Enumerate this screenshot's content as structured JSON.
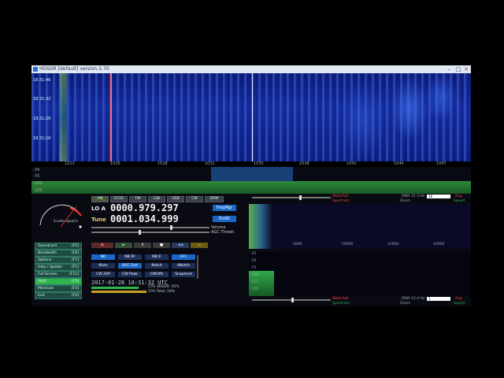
{
  "window": {
    "title": "HDSDR [default] version 2.70"
  },
  "waterfall": {
    "times": [
      "18:31:46",
      "18:31:32",
      "18:31:26",
      "18:31:16"
    ],
    "freq_ticks": [
      "1023",
      "1026",
      "1028",
      "1032",
      "1035",
      "1038",
      "1041",
      "1044",
      "1047"
    ]
  },
  "spectrum": {
    "level_ticks": [
      "-34",
      "-75",
      "-104",
      "-125"
    ]
  },
  "meter": {
    "label": "S-units Squelch"
  },
  "mode_buttons": [
    "AM",
    "ECSS",
    "FM",
    "LSB",
    "USB",
    "CW",
    "DRM"
  ],
  "lo": {
    "label": "LO A",
    "value": "0000.979.297"
  },
  "tune": {
    "label": "Tune",
    "value": "0001.034.999"
  },
  "buttons": {
    "freqmgr": "FreqMgr",
    "extio": "ExtIO"
  },
  "labels": {
    "volume": "Volume",
    "agc_thresh": "AGC Thresh."
  },
  "side_menu": [
    {
      "label": "Soundcard",
      "key": "[F5]"
    },
    {
      "label": "Bandwidth",
      "key": "[F6]"
    },
    {
      "label": "Options",
      "key": "[F7]"
    },
    {
      "label": "Help / Update",
      "key": "[F1]"
    },
    {
      "label": "Full Screen",
      "key": "[F11]"
    },
    {
      "label": "Start",
      "key": "[F2]"
    },
    {
      "label": "Minimize",
      "key": "[F3]"
    },
    {
      "label": "Exit",
      "key": "[F4]"
    }
  ],
  "agc_row": [
    "NR",
    "NB RF",
    "NB IF",
    "AFC"
  ],
  "dsp_row": [
    "Mute",
    "AGC Fast",
    "Notch",
    "ANotch"
  ],
  "misc_row": [
    "CW ZAP",
    "CW Peak",
    "CWOffs",
    "Snapmod"
  ],
  "status": {
    "datetime": "2017-01-28   18:31:32 UTC",
    "cpu_hdsdr": "CPU HDSDR:  45%",
    "cpu_total": "CPU Total:  59%"
  },
  "audio_top": {
    "waterfall_label": "Waterfall",
    "spectrum_label": "Spectrum",
    "rbw": "RBW 15.3 Hz",
    "zoom": "Zoom",
    "avg": "Avg.",
    "speed": "Speed",
    "fft_size": "16"
  },
  "audio_freq_ticks": [
    "5000",
    "10000",
    "15000",
    "20000"
  ],
  "audio_level_ticks": [
    "-25",
    "-50",
    "-75",
    "-100",
    "-125",
    "-150"
  ],
  "audio_bottom": {
    "waterfall_label": "Waterfall",
    "spectrum_label": "Spectrum",
    "rbw": "RBW 23.4 Hz",
    "zoom": "Zoom",
    "avg": "Avg.",
    "speed": "Speed",
    "fft_size": "1"
  },
  "colors": {
    "accent_blue": "#1a66c8",
    "green_button": "#2fb54a",
    "waterfall_bg": "#142a9a",
    "freq_digits": "#f4f4f4"
  }
}
